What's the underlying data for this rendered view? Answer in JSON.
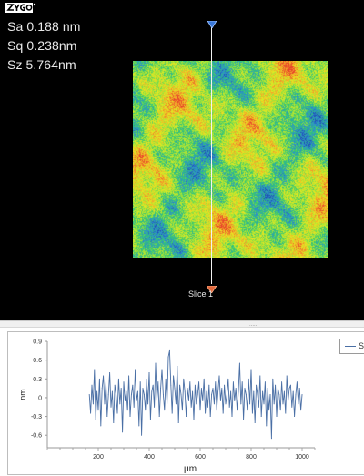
{
  "app": {
    "logo_text": "zygo"
  },
  "stats": {
    "sa": "Sa 0.188 nm",
    "sq": "Sq 0.238nm",
    "sz": "Sz 5.764nm"
  },
  "map": {
    "type": "surface height map",
    "colormap": [
      "#1f4fb0",
      "#2e8fd0",
      "#2ec37a",
      "#9be33a",
      "#e8e821",
      "#f2a12a",
      "#e8402a"
    ]
  },
  "slice": {
    "label": "Slice 1",
    "line_color": "#f2f2f2",
    "top_marker_color": "#3a78d8",
    "bottom_marker_color": "#e0663a"
  },
  "splitter": {
    "grip": "....."
  },
  "legend": {
    "label": "Sl"
  },
  "chart_data": {
    "type": "line",
    "title": "",
    "xlabel": "µm",
    "ylabel": "nm",
    "xlim": [
      0,
      1050
    ],
    "ylim": [
      -0.8,
      0.9
    ],
    "yticks": [
      -0.6,
      -0.3,
      0,
      0.3,
      0.6,
      0.9
    ],
    "ytick_labels": [
      "-0.6",
      "-0.3",
      "0",
      "0.3",
      "0.6",
      "0.9"
    ],
    "xticks": [
      200,
      400,
      600,
      800,
      1000
    ],
    "xtick_labels": [
      "200",
      "400",
      "600",
      "800",
      "1000"
    ],
    "grid": false,
    "legend_position": "top-right",
    "line_color": "#4a6fa5",
    "series": [
      {
        "name": "Sl",
        "x": [
          165,
          170,
          175,
          180,
          185,
          190,
          195,
          200,
          205,
          210,
          215,
          220,
          225,
          230,
          235,
          240,
          245,
          250,
          255,
          260,
          265,
          270,
          275,
          280,
          285,
          290,
          295,
          300,
          305,
          310,
          315,
          320,
          325,
          330,
          335,
          340,
          345,
          350,
          355,
          360,
          365,
          370,
          375,
          380,
          385,
          390,
          395,
          400,
          405,
          410,
          415,
          420,
          425,
          430,
          435,
          440,
          445,
          450,
          455,
          460,
          465,
          470,
          475,
          480,
          485,
          490,
          495,
          500,
          505,
          510,
          515,
          520,
          525,
          530,
          535,
          540,
          545,
          550,
          555,
          560,
          565,
          570,
          575,
          580,
          585,
          590,
          595,
          600,
          605,
          610,
          615,
          620,
          625,
          630,
          635,
          640,
          645,
          650,
          655,
          660,
          665,
          670,
          675,
          680,
          685,
          690,
          695,
          700,
          705,
          710,
          715,
          720,
          725,
          730,
          735,
          740,
          745,
          750,
          755,
          760,
          765,
          770,
          775,
          780,
          785,
          790,
          795,
          800,
          805,
          810,
          815,
          820,
          825,
          830,
          835,
          840,
          845,
          850,
          855,
          860,
          865,
          870,
          875,
          880,
          885,
          890,
          895,
          900,
          905,
          910,
          915,
          920,
          925,
          930,
          935,
          940,
          945,
          950,
          955,
          960,
          965,
          970,
          975,
          980,
          985,
          990,
          995,
          1000
        ],
        "y": [
          0.05,
          -0.25,
          0.2,
          -0.1,
          0.45,
          -0.35,
          0.1,
          -0.2,
          0.3,
          -0.45,
          0.15,
          0.35,
          -0.1,
          0.25,
          -0.3,
          0.05,
          0.4,
          -0.15,
          0.1,
          -0.4,
          0.2,
          0.05,
          -0.25,
          0.3,
          -0.1,
          0.15,
          -0.55,
          0.25,
          -0.05,
          0.1,
          -0.2,
          0.35,
          -0.3,
          0.05,
          0.2,
          -0.15,
          0.45,
          -0.05,
          0.1,
          -0.45,
          0.25,
          -0.6,
          0.15,
          0.05,
          -0.2,
          0.3,
          -0.1,
          0.4,
          -0.35,
          0.1,
          0.2,
          -0.15,
          0.55,
          -0.05,
          0.25,
          -0.3,
          0.15,
          0.45,
          0.05,
          -0.2,
          0.3,
          -0.1,
          0.65,
          0.75,
          0.2,
          -0.25,
          0.35,
          0.15,
          -0.1,
          0.5,
          -0.4,
          0.2,
          0.05,
          -0.2,
          0.3,
          0.1,
          -0.3,
          0.15,
          -0.05,
          0.25,
          -0.15,
          0.1,
          -0.35,
          0.2,
          -0.1,
          0.05,
          0.25,
          -0.2,
          0.15,
          -0.05,
          0.3,
          -0.25,
          0.1,
          -0.15,
          0.2,
          -0.3,
          0.05,
          0.15,
          -0.1,
          0.25,
          -0.2,
          0.1,
          0.35,
          -0.05,
          0.15,
          -0.25,
          0.2,
          -0.1,
          0.05,
          0.3,
          -0.15,
          0.1,
          -0.3,
          0.25,
          -0.05,
          0.15,
          -0.2,
          0.1,
          0.55,
          -0.1,
          0.25,
          -0.35,
          0.15,
          0.05,
          -0.2,
          0.3,
          -0.1,
          0.45,
          -0.25,
          0.1,
          -0.4,
          0.2,
          0.05,
          -0.15,
          0.35,
          -0.3,
          0.1,
          -0.1,
          0.25,
          -0.45,
          0.15,
          -0.2,
          0.05,
          -0.65,
          0.3,
          -0.1,
          0.2,
          -0.3,
          0.15,
          0.05,
          -0.2,
          0.25,
          -0.1,
          0.1,
          -0.25,
          0.35,
          -0.05,
          0.15,
          0.2,
          -0.15,
          0.1,
          -0.3,
          0.05,
          0.25,
          -0.1,
          0.15,
          -0.2,
          0.05
        ]
      }
    ]
  }
}
